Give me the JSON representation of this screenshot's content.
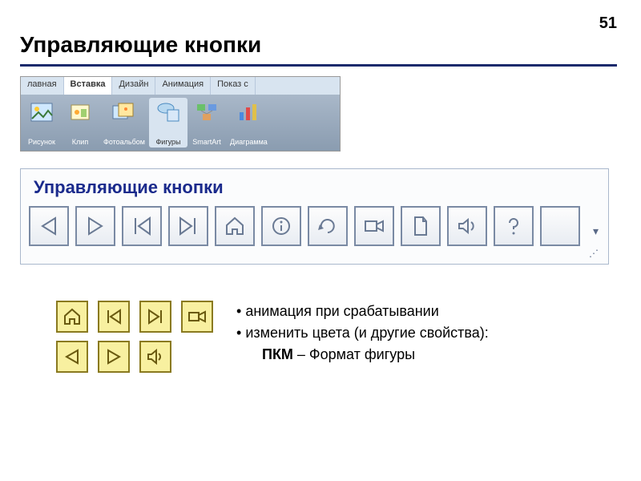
{
  "page_number": "51",
  "title": "Управляющие кнопки",
  "ribbon": {
    "tabs": [
      "лавная",
      "Вставка",
      "Дизайн",
      "Анимация",
      "Показ с"
    ],
    "active_tab_index": 1,
    "items": [
      {
        "label": "Рисунок",
        "icon": "picture-icon"
      },
      {
        "label": "Клип",
        "icon": "clip-icon"
      },
      {
        "label": "Фотоальбом",
        "icon": "album-icon"
      },
      {
        "label": "Фигуры",
        "icon": "shapes-icon",
        "selected": true
      },
      {
        "label": "SmartArt",
        "icon": "smartart-icon"
      },
      {
        "label": "Диаграмма",
        "icon": "chart-icon"
      }
    ]
  },
  "panel": {
    "title": "Управляющие кнопки",
    "buttons": [
      "triangle-left",
      "triangle-right",
      "bar-triangle-left",
      "triangle-right-bar",
      "home",
      "info",
      "return",
      "video",
      "document",
      "sound",
      "help",
      "blank"
    ]
  },
  "yellow_buttons_row1": [
    "home",
    "bar-triangle-left",
    "triangle-right-bar",
    "video"
  ],
  "yellow_buttons_row2": [
    "triangle-left",
    "triangle-right",
    "sound"
  ],
  "notes": {
    "line1": "анимация при срабатывании",
    "line2": "изменить цвета (и другие свойства):",
    "line3_bold": "ПКМ",
    "line3_rest": " – Формат фигуры"
  }
}
